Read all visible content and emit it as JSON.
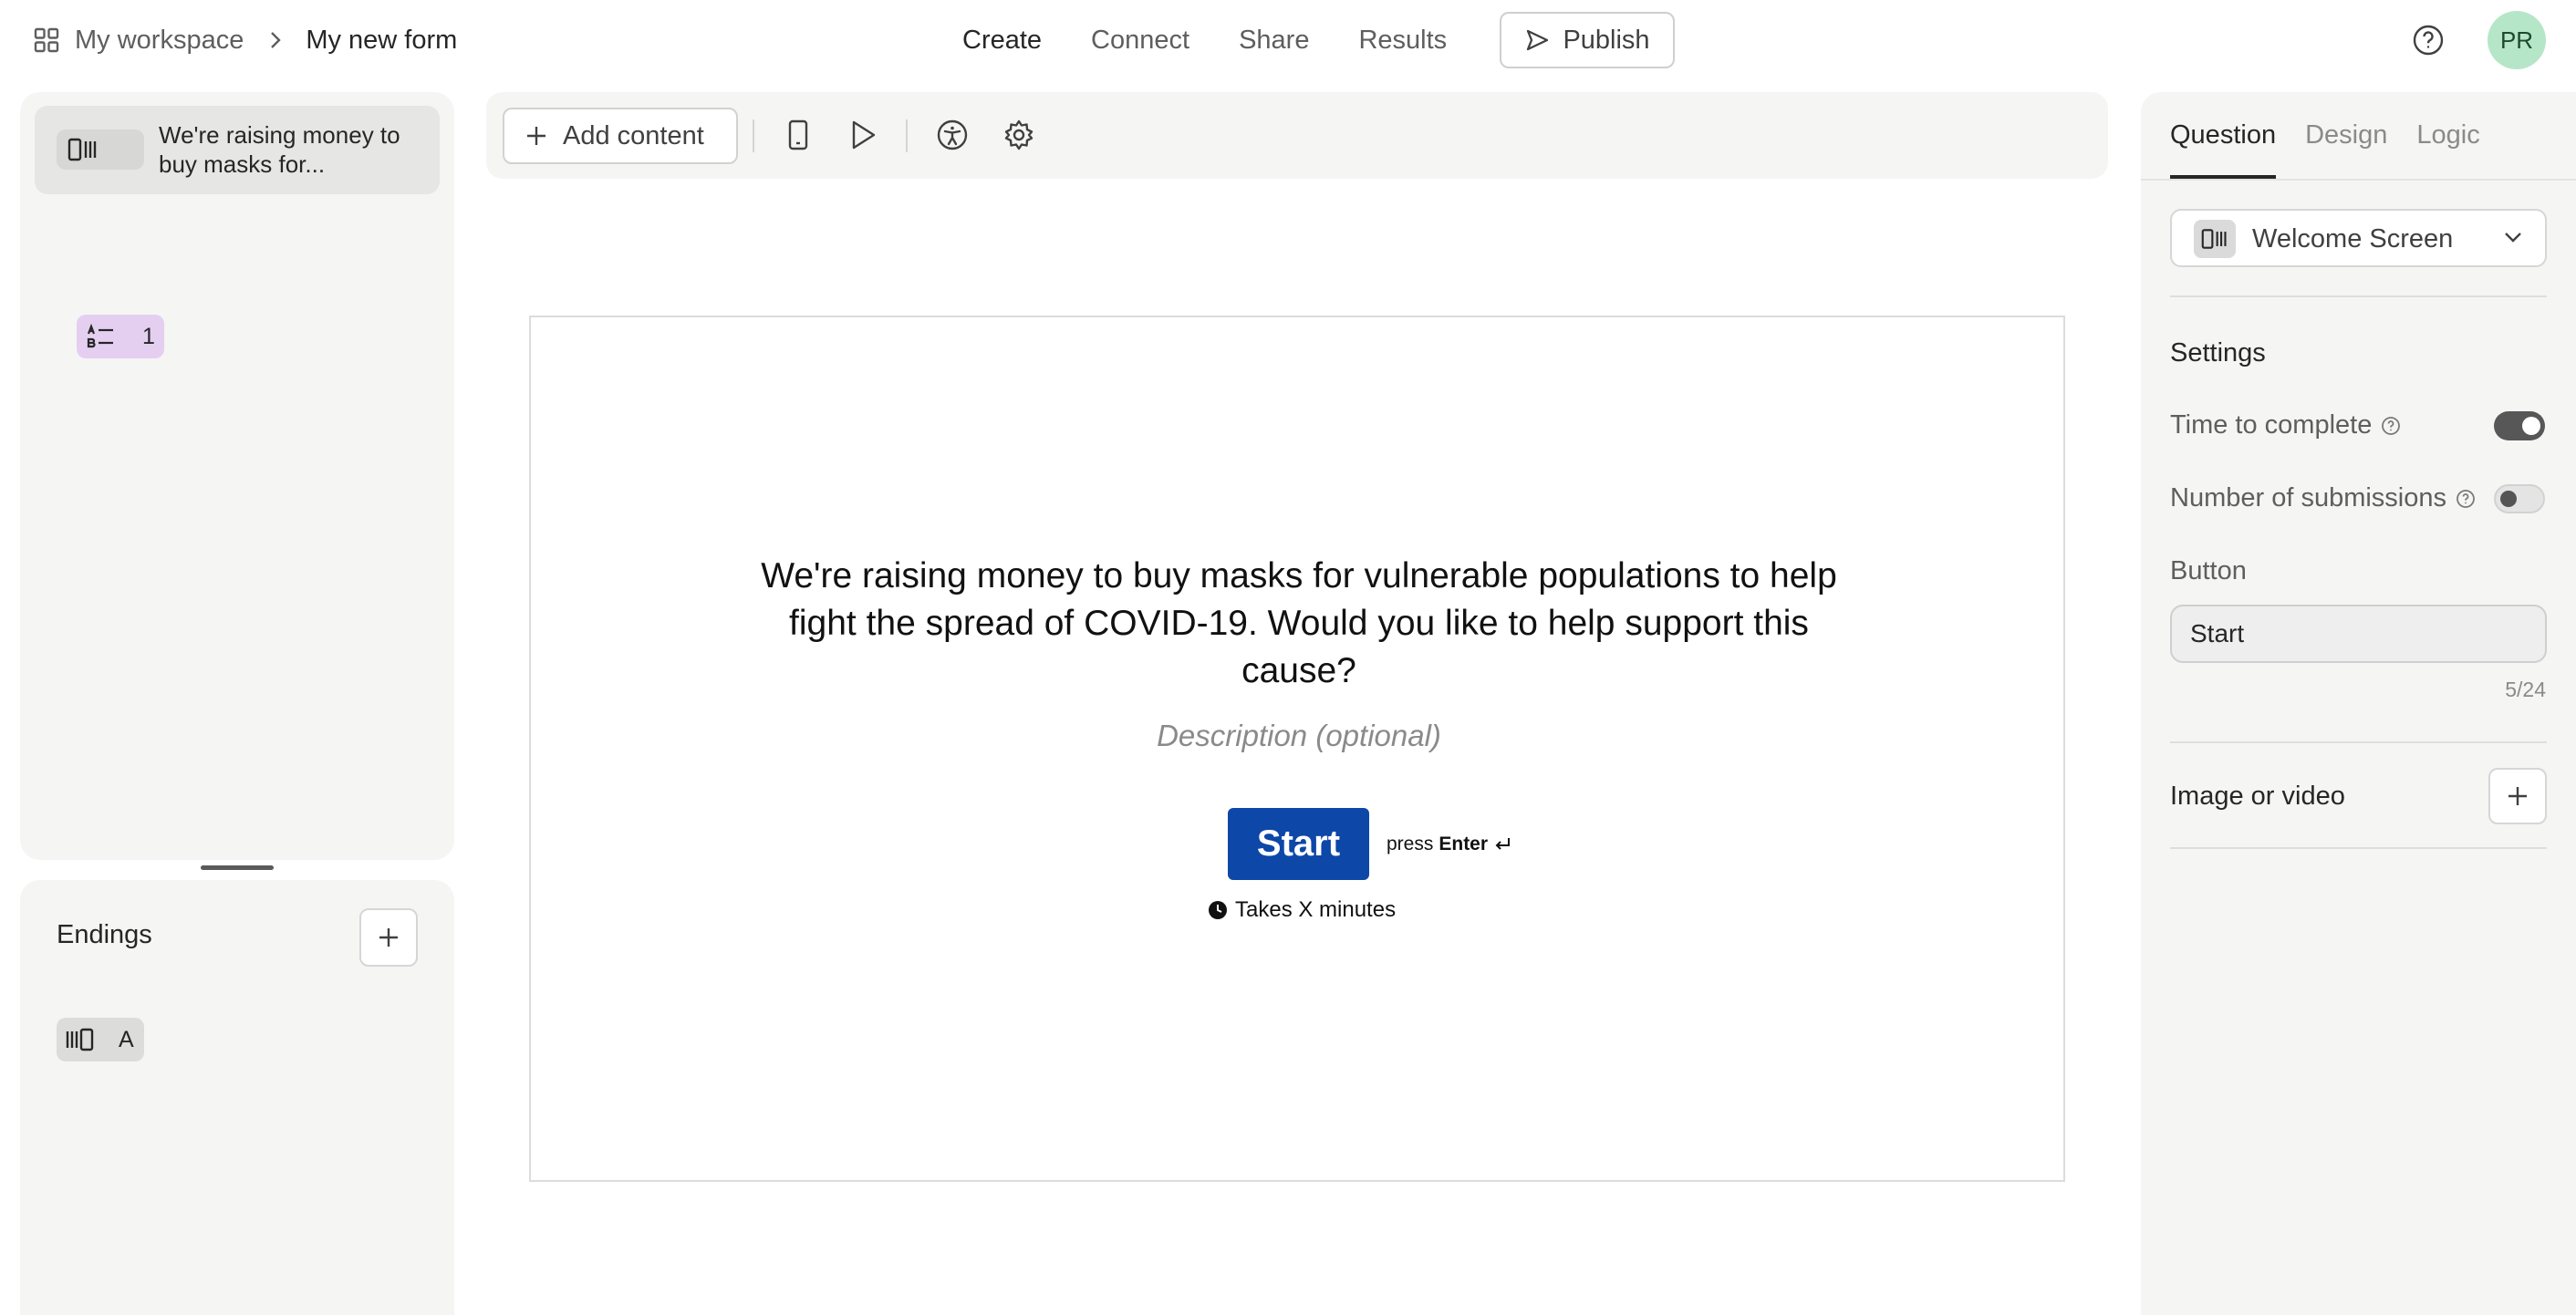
{
  "header": {
    "workspace": "My workspace",
    "form_name": "My new form",
    "tabs": [
      {
        "label": "Create",
        "active": true
      },
      {
        "label": "Connect",
        "active": false
      },
      {
        "label": "Share",
        "active": false
      },
      {
        "label": "Results",
        "active": false
      }
    ],
    "publish_label": "Publish",
    "avatar_initials": "PR",
    "avatar_color": "#b6e6c8"
  },
  "left_panel": {
    "questions": [
      {
        "icon": "welcome-screen-icon",
        "label": "We're raising money to buy masks for..."
      },
      {
        "icon": "multiple-choice-icon",
        "label": "1",
        "badge_color": "#e5cff1"
      }
    ],
    "endings": {
      "title": "Endings",
      "items": [
        {
          "icon": "ending-screen-icon",
          "label": "A"
        }
      ]
    }
  },
  "toolbar": {
    "add_content_label": "Add content"
  },
  "canvas": {
    "title": "We're raising money to buy masks for vulnerable populations to help fight the spread of COVID-19. Would you like to help support this cause?",
    "description_placeholder": "Description (optional)",
    "start_label": "Start",
    "start_color": "#0d47a8",
    "press_prefix": "press",
    "press_key": "Enter",
    "takes_label": "Takes X minutes"
  },
  "right_panel": {
    "tabs": [
      {
        "label": "Question",
        "active": true
      },
      {
        "label": "Design",
        "active": false
      },
      {
        "label": "Logic",
        "active": false
      }
    ],
    "type_value": "Welcome Screen",
    "settings_heading": "Settings",
    "time_to_complete": {
      "label": "Time to complete",
      "enabled": true
    },
    "number_of_submissions": {
      "label": "Number of submissions",
      "enabled": false
    },
    "button_label": "Button",
    "button_value": "Start",
    "button_counter": "5/24",
    "image_or_video": "Image or video"
  }
}
